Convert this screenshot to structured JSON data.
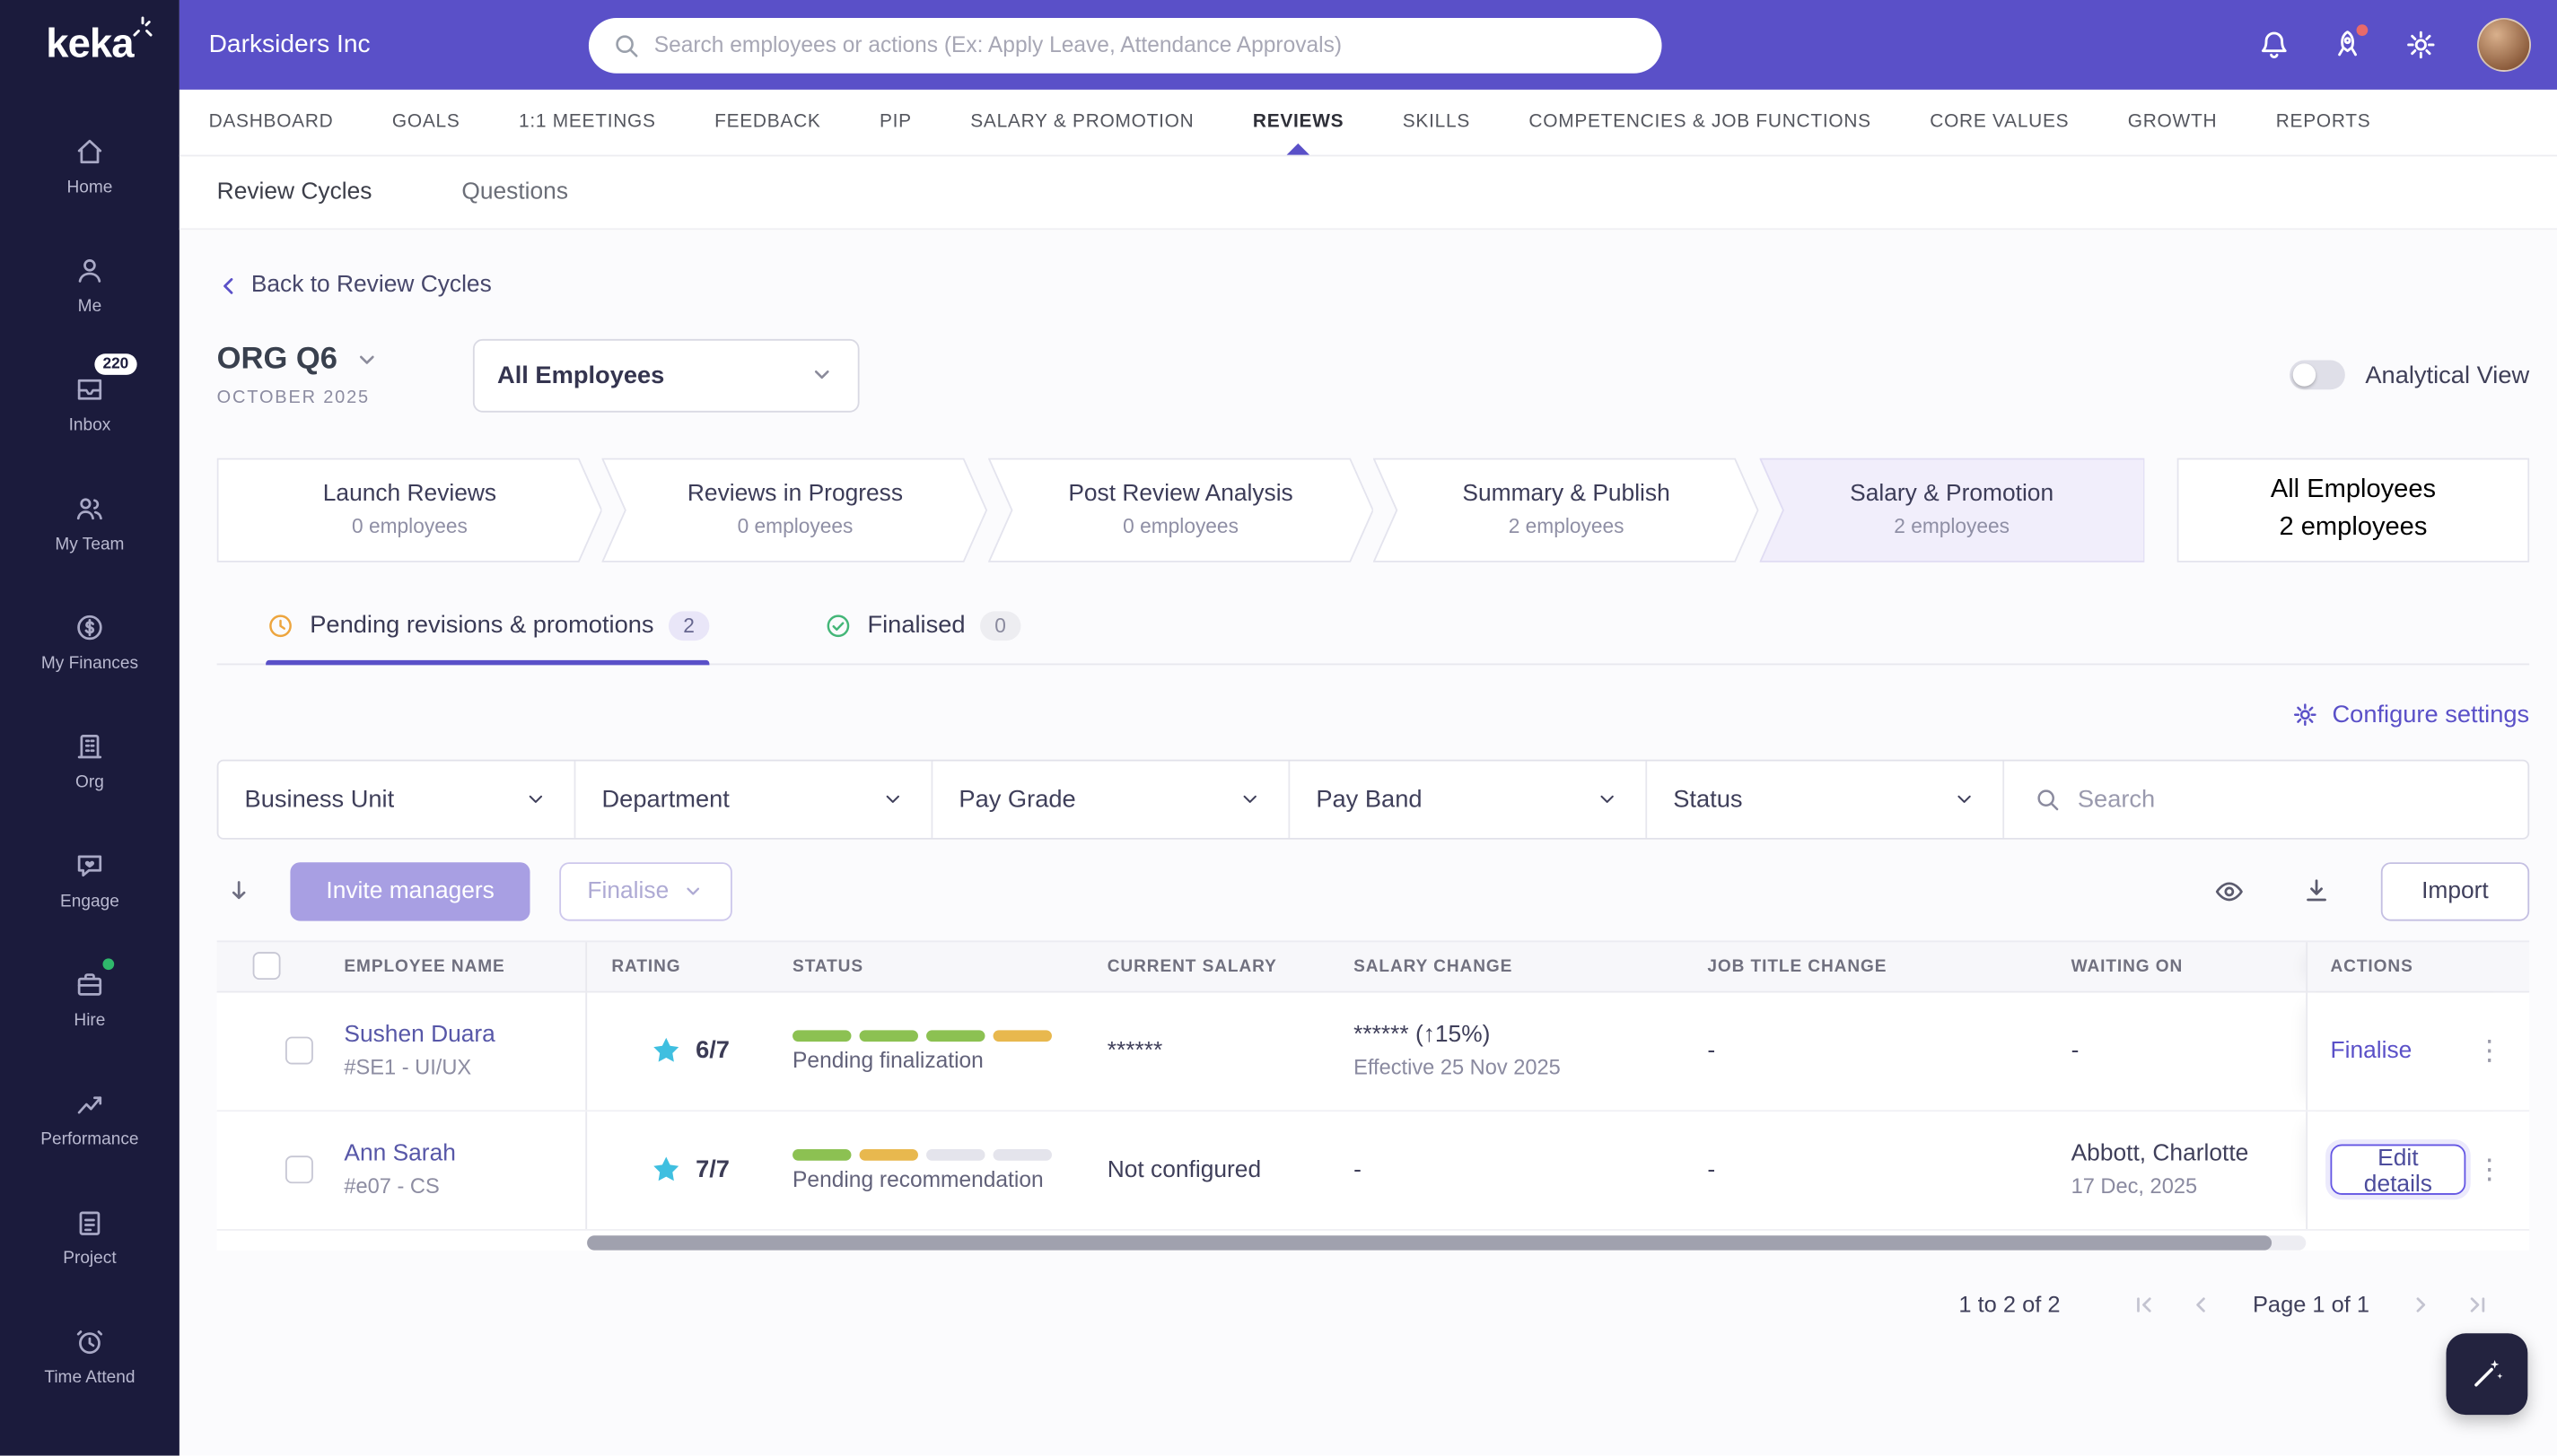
{
  "colors": {
    "accent": "#5a50c8",
    "topbar": "#5a50c8",
    "sidebar_bg": "#1b1b3c",
    "green": "#8cc152",
    "amber": "#e8b84e",
    "bar_gray": "#e4e4ec",
    "star": "#3fbfe0"
  },
  "topbar": {
    "brand": "keka",
    "company": "Darksiders Inc",
    "search_placeholder": "Search employees or actions (Ex: Apply Leave, Attendance Approvals)"
  },
  "sidebar": {
    "items": [
      {
        "label": "Home",
        "icon": "home-icon"
      },
      {
        "label": "Me",
        "icon": "user-icon"
      },
      {
        "label": "Inbox",
        "icon": "inbox-icon",
        "badge": "220"
      },
      {
        "label": "My Team",
        "icon": "team-icon"
      },
      {
        "label": "My Finances",
        "icon": "finances-icon"
      },
      {
        "label": "Org",
        "icon": "org-icon"
      },
      {
        "label": "Engage",
        "icon": "engage-icon"
      },
      {
        "label": "Hire",
        "icon": "hire-icon",
        "dot": true
      },
      {
        "label": "Performance",
        "icon": "performance-icon"
      },
      {
        "label": "Project",
        "icon": "project-icon"
      },
      {
        "label": "Time Attend",
        "icon": "time-attend-icon"
      }
    ]
  },
  "nav": {
    "items": [
      "DASHBOARD",
      "GOALS",
      "1:1 MEETINGS",
      "FEEDBACK",
      "PIP",
      "SALARY & PROMOTION",
      "REVIEWS",
      "SKILLS",
      "COMPETENCIES & JOB FUNCTIONS",
      "CORE VALUES",
      "GROWTH",
      "REPORTS"
    ],
    "active": "REVIEWS"
  },
  "subnav": {
    "items": [
      "Review Cycles",
      "Questions"
    ],
    "active": "Review Cycles"
  },
  "page": {
    "back_link": "Back to Review Cycles",
    "cycle_title": "ORG Q6",
    "cycle_period": "OCTOBER 2025",
    "employee_scope": "All Employees",
    "analytical_view_label": "Analytical View",
    "configure_settings_label": "Configure settings"
  },
  "stages": [
    {
      "title": "Launch Reviews",
      "subtitle": "0 employees"
    },
    {
      "title": "Reviews in Progress",
      "subtitle": "0 employees"
    },
    {
      "title": "Post Review Analysis",
      "subtitle": "0 employees"
    },
    {
      "title": "Summary & Publish",
      "subtitle": "2 employees"
    },
    {
      "title": "Salary & Promotion",
      "subtitle": "2 employees",
      "active": true
    },
    {
      "title": "All Employees",
      "subtitle": "2 employees",
      "standalone": true
    }
  ],
  "tabs": [
    {
      "label": "Pending revisions & promotions",
      "badge": "2",
      "icon": "pending-icon",
      "active": true
    },
    {
      "label": "Finalised",
      "badge": "0",
      "icon": "finalised-icon",
      "active": false
    }
  ],
  "filters": {
    "selects": [
      "Business Unit",
      "Department",
      "Pay Grade",
      "Pay Band",
      "Status"
    ],
    "search_placeholder": "Search"
  },
  "toolbar": {
    "invite_label": "Invite managers",
    "finalise_label": "Finalise",
    "import_label": "Import"
  },
  "table": {
    "headers": [
      "EMPLOYEE NAME",
      "RATING",
      "STATUS",
      "CURRENT SALARY",
      "SALARY CHANGE",
      "JOB TITLE CHANGE",
      "WAITING ON",
      "ACTIONS"
    ],
    "rows": [
      {
        "name": "Sushen Duara",
        "employee_id": "#SE1 - UI/UX",
        "rating": "6/7",
        "progress": [
          "green",
          "green",
          "green",
          "amber"
        ],
        "status": "Pending finalization",
        "current_salary": "******",
        "salary_change": "****** (↑15%)",
        "salary_change_note": "Effective 25 Nov 2025",
        "job_title_change": "-",
        "waiting_on": "-",
        "waiting_on_note": "",
        "action": "Finalise",
        "action_style": "link"
      },
      {
        "name": "Ann Sarah",
        "employee_id": "#e07 - CS",
        "rating": "7/7",
        "progress": [
          "green",
          "amber",
          "gray",
          "gray"
        ],
        "status": "Pending recommendation",
        "current_salary": "Not configured",
        "salary_change": "-",
        "salary_change_note": "",
        "job_title_change": "-",
        "waiting_on": "Abbott, Charlotte",
        "waiting_on_note": "17 Dec, 2025",
        "action": "Edit details",
        "action_style": "button"
      }
    ]
  },
  "pagination": {
    "range": "1 to 2 of 2",
    "page": "Page 1 of 1"
  }
}
